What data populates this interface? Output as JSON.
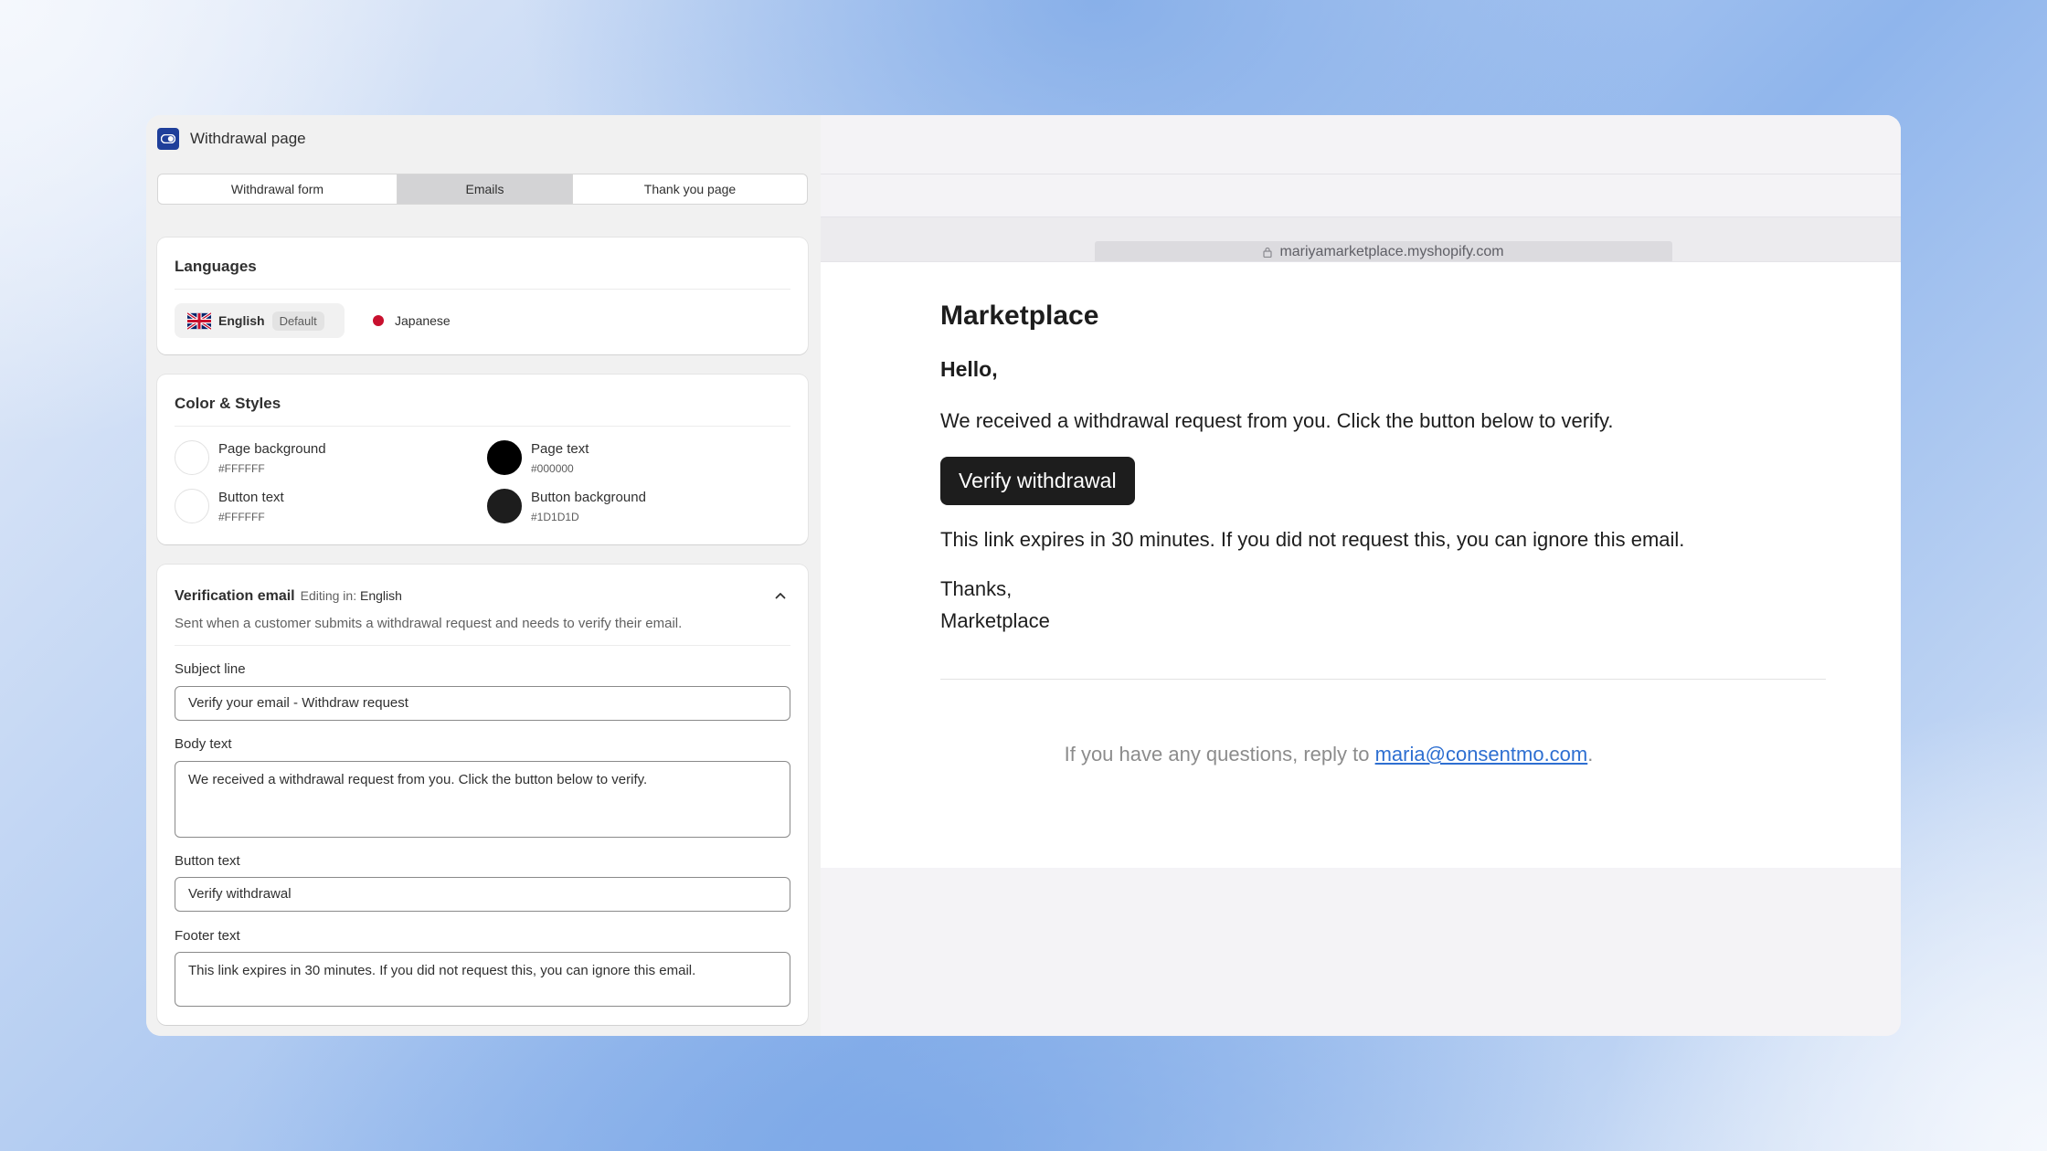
{
  "app": {
    "title": "Withdrawal page",
    "icon": "toggle-icon"
  },
  "tabs": [
    {
      "label": "Withdrawal form",
      "active": false
    },
    {
      "label": "Emails",
      "active": true
    },
    {
      "label": "Thank you page",
      "active": false
    }
  ],
  "languages": {
    "title": "Languages",
    "items": [
      {
        "name": "English",
        "badge": "Default",
        "icon": "uk-flag-icon"
      },
      {
        "name": "Japanese",
        "icon": "japan-dot-icon"
      }
    ]
  },
  "colors": {
    "title": "Color & Styles",
    "items": [
      {
        "label": "Page background",
        "hex": "#FFFFFF"
      },
      {
        "label": "Page text",
        "hex": "#000000"
      },
      {
        "label": "Button text",
        "hex": "#FFFFFF"
      },
      {
        "label": "Button background",
        "hex": "#1D1D1D"
      }
    ]
  },
  "verification": {
    "title": "Verification email",
    "editing_prefix": "Editing in:",
    "editing_lang": "English",
    "description": "Sent when a customer submits a withdrawal request and needs to verify their email.",
    "subject_label": "Subject line",
    "subject_value": "Verify your email - Withdraw request",
    "body_label": "Body text",
    "body_value": "We received a withdrawal request from you. Click the button below to verify.",
    "button_label": "Button text",
    "button_value": "Verify withdrawal",
    "footer_label": "Footer text",
    "footer_value": "This link expires in 30 minutes. If you did not request this, you can ignore this email."
  },
  "preview": {
    "url": "mariyamarketplace.myshopify.com",
    "brand": "Marketplace",
    "greeting": "Hello,",
    "body": "We received a withdrawal request from you. Click the button below to verify.",
    "button": "Verify withdrawal",
    "footer": "This link expires in 30 minutes. If you did not request this, you can ignore this email.",
    "thanks": "Thanks,",
    "signature": "Marketplace",
    "contact_prefix": "If you have any questions, reply to",
    "contact_email": "maria@consentmo.com",
    "contact_suffix": "."
  }
}
